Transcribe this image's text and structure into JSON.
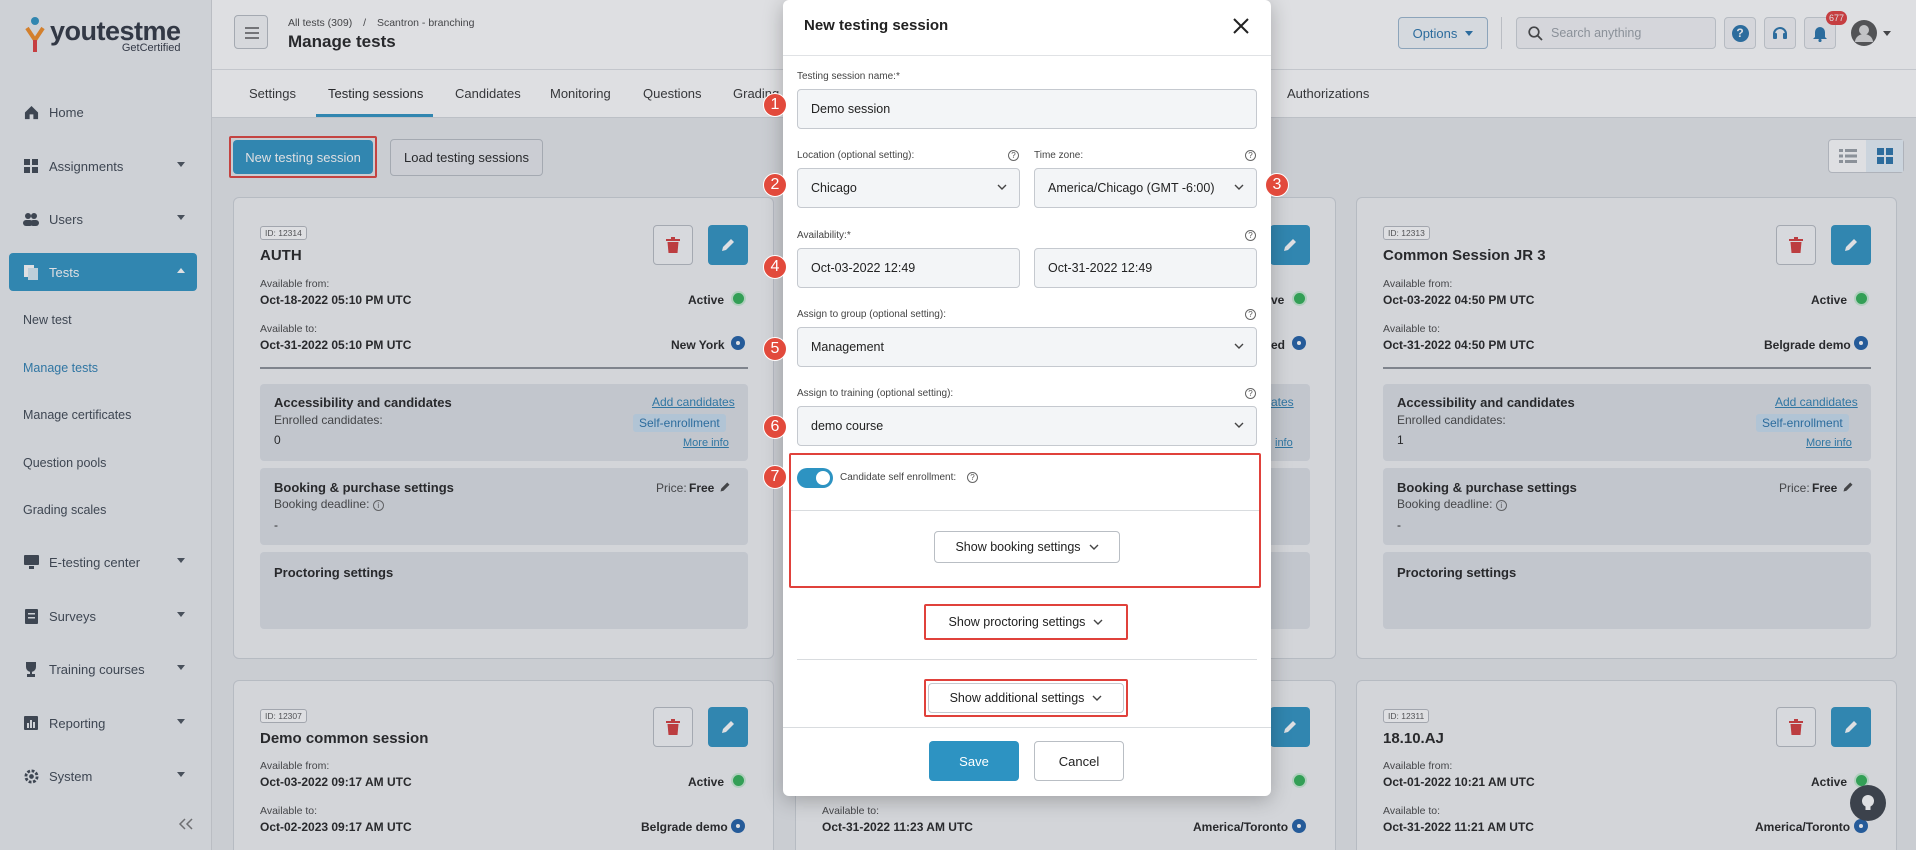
{
  "brand": {
    "name": "youtestme",
    "sub": "GetCertified"
  },
  "sidebar": {
    "items": [
      {
        "label": "Home",
        "icon": "home-icon"
      },
      {
        "label": "Assignments",
        "icon": "grid-icon"
      },
      {
        "label": "Users",
        "icon": "users-icon"
      },
      {
        "label": "Tests",
        "icon": "tests-icon"
      },
      {
        "label": "E-testing center",
        "icon": "monitor-icon"
      },
      {
        "label": "Surveys",
        "icon": "survey-icon"
      },
      {
        "label": "Training courses",
        "icon": "trophy-icon"
      },
      {
        "label": "Reporting",
        "icon": "chart-icon"
      },
      {
        "label": "System",
        "icon": "gear-icon"
      }
    ],
    "tests_sub": [
      "New test",
      "Manage tests",
      "Manage certificates",
      "Question pools",
      "Grading scales"
    ]
  },
  "header": {
    "breadcrumb_root": "All tests (309)",
    "breadcrumb_sep": "/",
    "breadcrumb_leaf": "Scantron - branching",
    "title": "Manage tests",
    "options_label": "Options",
    "search_placeholder": "Search anything",
    "notif_count": "677"
  },
  "tabs": [
    "Settings",
    "Testing sessions",
    "Candidates",
    "Monitoring",
    "Questions",
    "Grading",
    "Authorizations"
  ],
  "actions": {
    "new_session": "New testing session",
    "load_sessions": "Load testing sessions"
  },
  "cards": [
    {
      "id": "ID: 12314",
      "title": "AUTH",
      "from_label": "Available from:",
      "from": "Oct-18-2022 05:10 PM UTC",
      "to_label": "Available to:",
      "to": "Oct-31-2022 05:10 PM UTC",
      "status": "Active",
      "location": "New York",
      "acc_title": "Accessibility and candidates",
      "enrolled_label": "Enrolled candidates:",
      "enrolled": "0",
      "add_link": "Add candidates",
      "self_label": "Self-enrollment",
      "more": "More info",
      "booking_title": "Booking & purchase settings",
      "deadline_label": "Booking deadline:",
      "deadline": "-",
      "price_label": "Price:",
      "price": "Free",
      "proctor_title": "Proctoring settings"
    },
    {
      "id": "ID: 12313",
      "title": "Common Session JR 3",
      "from_label": "Available from:",
      "from": "Oct-03-2022 04:50 PM UTC",
      "to_label": "Available to:",
      "to": "Oct-31-2022 04:50 PM UTC",
      "status": "Active",
      "location": "Belgrade demo",
      "acc_title": "Accessibility and candidates",
      "enrolled_label": "Enrolled candidates:",
      "enrolled": "1",
      "add_link": "Add candidates",
      "self_label": "Self-enrollment",
      "more": "More info",
      "booking_title": "Booking & purchase settings",
      "deadline_label": "Booking deadline:",
      "deadline": "-",
      "price_label": "Price:",
      "price": "Free",
      "proctor_title": "Proctoring settings"
    },
    {
      "id": "ID: 12307",
      "title": "Demo common session",
      "from_label": "Available from:",
      "from": "Oct-03-2022 09:17 AM UTC",
      "to_label": "Available to:",
      "to": "Oct-02-2023 09:17 AM UTC",
      "status": "Active",
      "location": "Belgrade demo"
    },
    {
      "id": "ID: 12311",
      "title": "18.10.AJ",
      "from_label": "Available from:",
      "from": "Oct-01-2022 10:21 AM UTC",
      "to_label": "Available to:",
      "to": "Oct-31-2022 11:21 AM UTC",
      "status": "Active",
      "location": "America/Toronto"
    }
  ],
  "middle_partial": {
    "status_tail": "ve",
    "loc_tail_1": "ed",
    "link_tail": "ates",
    "more_tail": "info",
    "to_label": "Available to:",
    "to": "Oct-31-2022 11:23 AM UTC",
    "location": "America/Toronto"
  },
  "modal": {
    "title": "New testing session",
    "name_label": "Testing session name:*",
    "name_value": "Demo session",
    "location_label": "Location (optional setting):",
    "location_value": "Chicago",
    "timezone_label": "Time zone:",
    "timezone_value": "America/Chicago (GMT -6:00)",
    "availability_label": "Availability:*",
    "avail_from": "Oct-03-2022 12:49",
    "avail_to": "Oct-31-2022 12:49",
    "group_label": "Assign to group (optional setting):",
    "group_value": "Management",
    "training_label": "Assign to training (optional setting):",
    "training_value": "demo course",
    "self_enroll_label": "Candidate self enrollment:",
    "self_enroll_on": true,
    "booking_btn": "Show booking settings",
    "proctoring_btn": "Show proctoring settings",
    "additional_btn": "Show additional settings",
    "save": "Save",
    "cancel": "Cancel",
    "steps": [
      "1",
      "2",
      "3",
      "4",
      "5",
      "6",
      "7"
    ]
  },
  "colors": {
    "primary": "#2d93c2",
    "callout": "#e24a3c",
    "highlight": "#e0413b",
    "active": "#2fb155"
  }
}
